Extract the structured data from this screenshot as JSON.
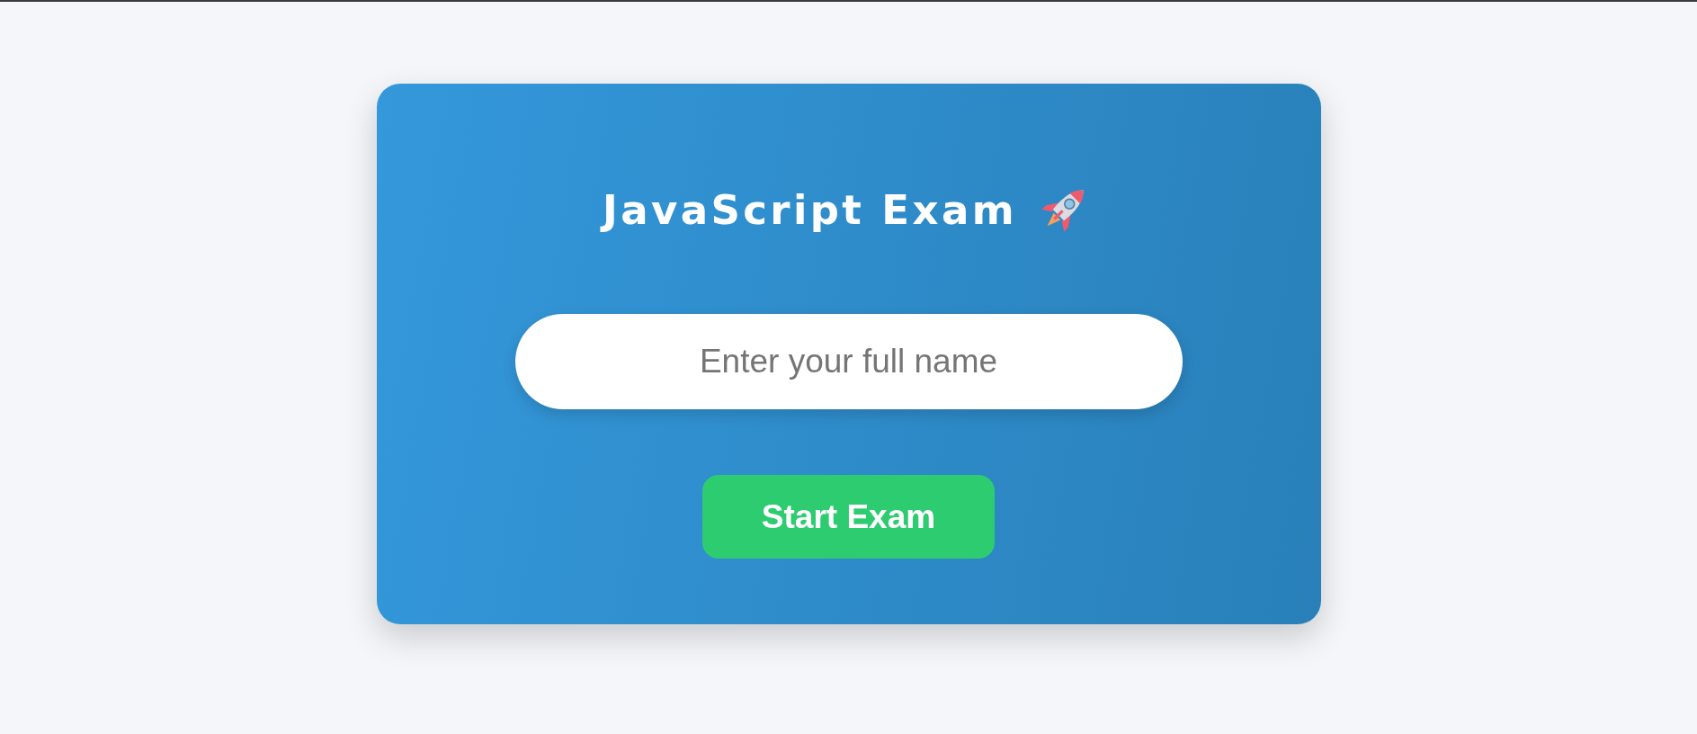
{
  "card": {
    "title": "JavaScript Exam",
    "name_field": {
      "placeholder": "Enter your full name"
    },
    "start_button": {
      "label": "Start Exam"
    }
  }
}
